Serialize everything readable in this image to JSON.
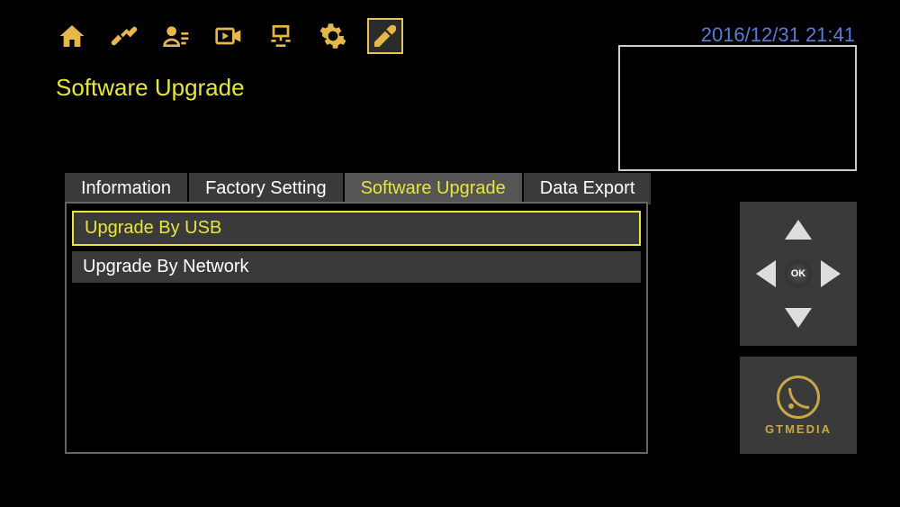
{
  "datetime": "2016/12/31  21:41",
  "page_title": "Software Upgrade",
  "top_icons": [
    {
      "name": "home-icon"
    },
    {
      "name": "satellite-icon"
    },
    {
      "name": "user-icon"
    },
    {
      "name": "video-icon"
    },
    {
      "name": "network-icon"
    },
    {
      "name": "settings-icon"
    },
    {
      "name": "tools-icon"
    }
  ],
  "tabs": [
    {
      "label": "Information",
      "active": false
    },
    {
      "label": "Factory Setting",
      "active": false
    },
    {
      "label": "Software Upgrade",
      "active": true
    },
    {
      "label": "Data Export",
      "active": false
    }
  ],
  "menu_items": [
    {
      "label": "Upgrade By USB",
      "selected": true
    },
    {
      "label": "Upgrade By Network",
      "selected": false
    }
  ],
  "dpad_ok": "OK",
  "brand": "GTMEDIA"
}
